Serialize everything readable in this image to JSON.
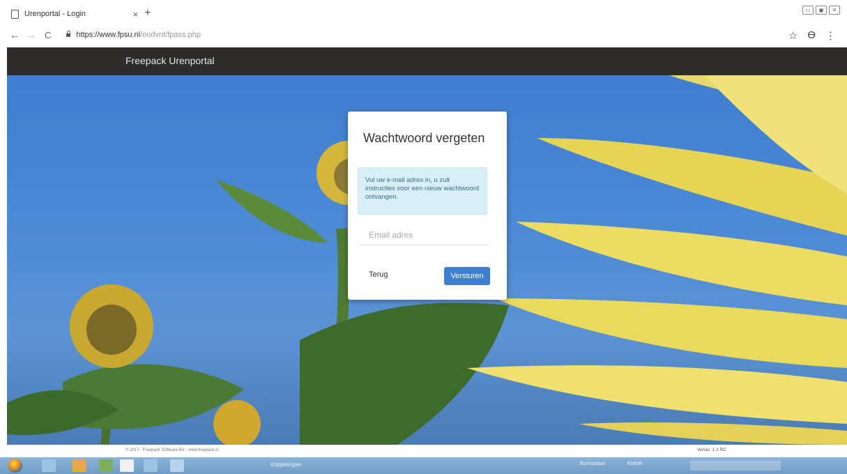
{
  "browser": {
    "tab_title": "Urenportal - Login",
    "tab_close": "×",
    "new_tab": "+",
    "url_host": "https://www.fpsu.nl",
    "url_path": "/oudvnt/fpass.php",
    "nav_back": "←",
    "nav_forward": "→",
    "nav_reload": "C",
    "bookmark_star": "☆",
    "profile": "ϴ",
    "menu": "⋮",
    "window_controls": [
      "▭",
      "▣",
      "✕"
    ]
  },
  "navbar": {
    "brand": "Freepack Urenportal"
  },
  "modal": {
    "title": "Wachtwoord vergeten",
    "info_text": "Vul uw e-mail adres in, u zult instructies voor een nieuw wachtwoord ontvangen.",
    "email_placeholder": "Email adres",
    "back_label": "Terug",
    "send_label": "Versturen"
  },
  "footer": {
    "copyright": "© 2017 - Freepack Software BV - www.freepack.nl",
    "version": "Versie: 1.2 RC"
  },
  "taskbar": {
    "window_label": "Koppelingen",
    "tray_desktop": "Bureaublad",
    "tray_eigen": "Eiafoth"
  },
  "colors": {
    "navbar": "#2e2c2b",
    "primary_button": "#3f7fd1",
    "info_background": "#d9eef7",
    "info_text": "#31708f"
  }
}
